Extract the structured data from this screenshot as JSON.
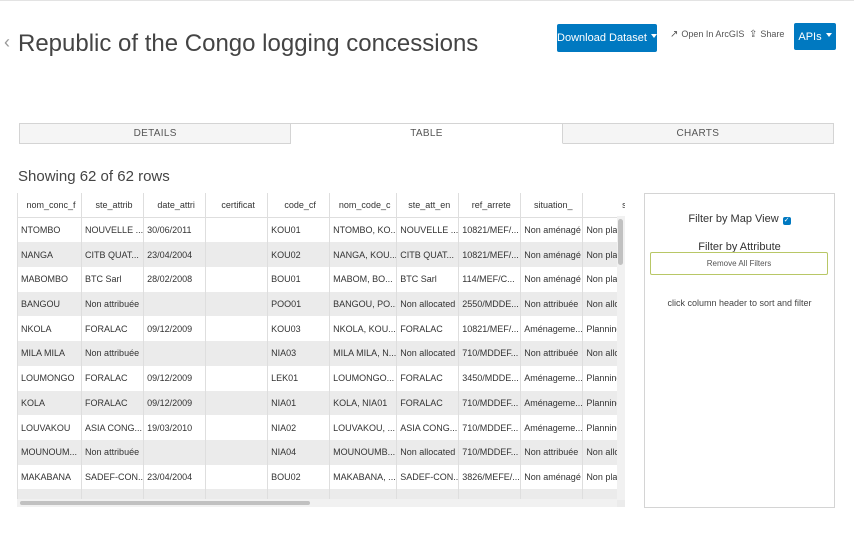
{
  "header": {
    "back_icon": "chevron-left-icon",
    "title": "Republic of the Congo logging concessions",
    "download_label": "Download Dataset",
    "open_arcgis_label": "Open In ArcGIS",
    "share_label": "Share",
    "apis_label": "APIs"
  },
  "tabs": [
    {
      "label": "DETAILS"
    },
    {
      "label": "TABLE"
    },
    {
      "label": "CHARTS"
    }
  ],
  "table": {
    "showing_text": "Showing 62 of 62 rows",
    "columns": [
      "nom_conc_f",
      "ste_attrib",
      "date_attri",
      "certificat",
      "code_cf",
      "nom_code_c",
      "ste_att_en",
      "ref_arrete",
      "situation_",
      "sit_eng"
    ],
    "rows": [
      [
        "NTOMBO",
        "NOUVELLE ...",
        "30/06/2011",
        "",
        "KOU01",
        "NTOMBO, KO...",
        "NOUVELLE ...",
        "10821/MEF/...",
        "Non aménagé",
        "Non pla"
      ],
      [
        "NANGA",
        "CITB QUAT...",
        "23/04/2004",
        "",
        "KOU02",
        "NANGA, KOU...",
        "CITB QUAT...",
        "10821/MEF/...",
        "Non aménagé",
        "Non pla"
      ],
      [
        "MABOMBO",
        "BTC Sarl",
        "28/02/2008",
        "",
        "BOU01",
        "MABOM, BO...",
        "BTC Sarl",
        "114/MEF/C...",
        "Non aménagé",
        "Non pla"
      ],
      [
        "BANGOU",
        "Non attribuée",
        "",
        "",
        "POO01",
        "BANGOU, PO...",
        "Non allocated",
        "2550/MDDE...",
        "Non attribuée",
        "Non allo"
      ],
      [
        "NKOLA",
        "FORALAC",
        "09/12/2009",
        "",
        "KOU03",
        "NKOLA, KOU...",
        "FORALAC",
        "10821/MEF/...",
        "Aménageme...",
        "Planning"
      ],
      [
        "MILA MILA",
        "Non attribuée",
        "",
        "",
        "NIA03",
        "MILA MILA, N...",
        "Non allocated",
        "710/MDDEF...",
        "Non attribuée",
        "Non allo"
      ],
      [
        "LOUMONGO",
        "FORALAC",
        "09/12/2009",
        "",
        "LEK01",
        "LOUMONGO...",
        "FORALAC",
        "3450/MDDE...",
        "Aménageme...",
        "Planning"
      ],
      [
        "KOLA",
        "FORALAC",
        "09/12/2009",
        "",
        "NIA01",
        "KOLA, NIA01",
        "FORALAC",
        "710/MDDEF...",
        "Aménageme...",
        "Planning"
      ],
      [
        "LOUVAKOU",
        "ASIA CONG...",
        "19/03/2010",
        "",
        "NIA02",
        "LOUVAKOU, ...",
        "ASIA CONG...",
        "710/MDDEF...",
        "Aménageme...",
        "Planning"
      ],
      [
        "MOUNOUM...",
        "Non attribuée",
        "",
        "",
        "NIA04",
        "MOUNOUMB...",
        "Non allocated",
        "710/MDDEF...",
        "Non attribuée",
        "Non allo"
      ],
      [
        "MAKABANA",
        "SADEF-CON...",
        "23/04/2004",
        "",
        "BOU02",
        "MAKABANA, ...",
        "SADEF-CON...",
        "3826/MEFE/...",
        "Non aménagé",
        "Non pla"
      ],
      [
        "",
        "",
        "",
        "",
        "",
        "",
        "",
        "",
        "",
        ""
      ]
    ]
  },
  "filters": {
    "map_view_label": "Filter by Map View",
    "map_view_checked": true,
    "attribute_label": "Filter by Attribute",
    "remove_all_label": "Remove All Filters",
    "hint": "click column header to sort and filter"
  },
  "colors": {
    "brand_blue": "#0079c1",
    "row_stripe": "#ebebeb",
    "remove_filter_border": "#b8c766"
  }
}
